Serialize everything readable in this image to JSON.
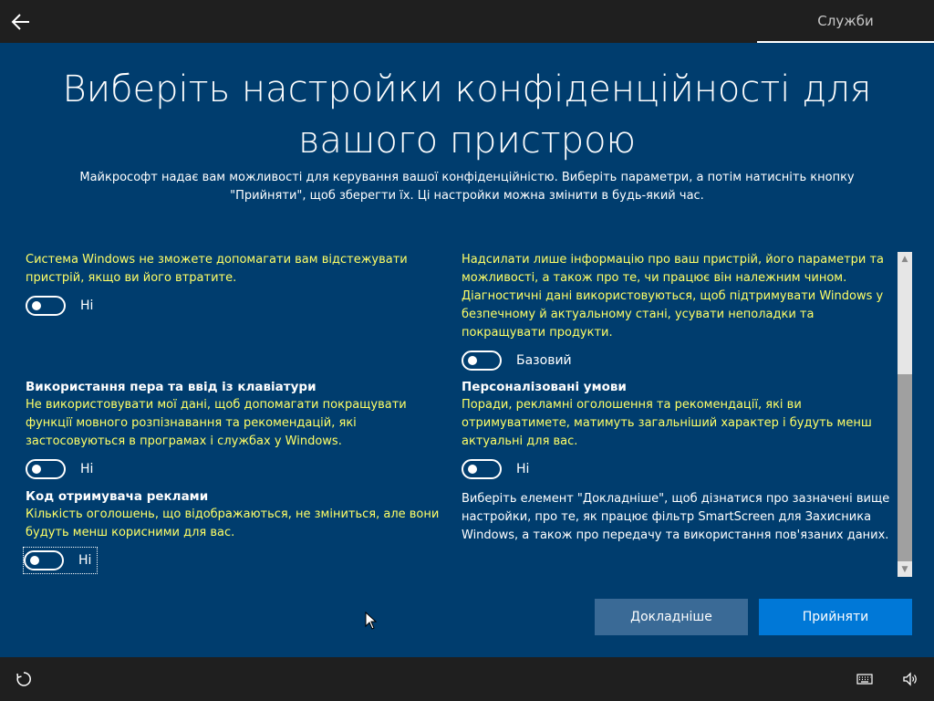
{
  "header": {
    "back_icon": "arrow-left-icon",
    "services_tab": "Служби"
  },
  "main": {
    "title": "Виберіть настройки конфіденційності для вашого пристрою",
    "subtitle": "Майкрософт надає вам можливості для керування вашої конфіденційністю. Виберіть параметри, а потім натисніть кнопку \"Прийняти\", щоб зберегти їх. Ці настройки можна змінити в будь-який час."
  },
  "settings": {
    "find_device": {
      "description": "Система Windows не зможете допомагати вам відстежувати пристрій, якщо ви його втратите.",
      "toggle_label": "Ні"
    },
    "ink_typing": {
      "heading": "Використання пера та ввід із клавіатури",
      "description": "Не використовувати мої дані, щоб допомагати покращувати функції мовного розпізнавання та рекомендацій, які застосовуються в програмах і службах у Windows.",
      "toggle_label": "Ні"
    },
    "advertising_id": {
      "heading": "Код отримувача реклами",
      "description": "Кількість оголошень, що відображаються, не зміниться, але вони будуть менш корисними для вас.",
      "toggle_label": "Ні"
    },
    "diagnostics": {
      "description": "Надсилати лише інформацію про ваш пристрій, його параметри та можливості, а також про те, чи працює він належним чином. Діагностичні дані використовуються, щоб підтримувати Windows у безпечному й актуальному стані, усувати неполадки та покращувати продукти.",
      "toggle_label": "Базовий"
    },
    "tailored": {
      "heading": "Персоналізовані умови",
      "description": "Поради, рекламні оголошення та рекомендації, які ви отримуватимете, матимуть загальніший характер і будуть менш актуальні для вас.",
      "toggle_label": "Ні"
    },
    "learn_more_note": "Виберіть елемент \"Докладніше\", щоб дізнатися про зазначені вище настройки, про те, як працює фільтр SmartScreen для Захисника Windows, а також про передачу та використання пов'язаних даних."
  },
  "buttons": {
    "learn_more": "Докладніше",
    "accept": "Прийняти"
  },
  "footer": {
    "left_icon": "ease-of-access-icon",
    "keyboard_icon": "keyboard-icon",
    "volume_icon": "volume-icon"
  },
  "colors": {
    "background": "#003d6e",
    "bar": "#1f1f1f",
    "accent": "#0078d7",
    "highlight_text": "#ffff66"
  }
}
